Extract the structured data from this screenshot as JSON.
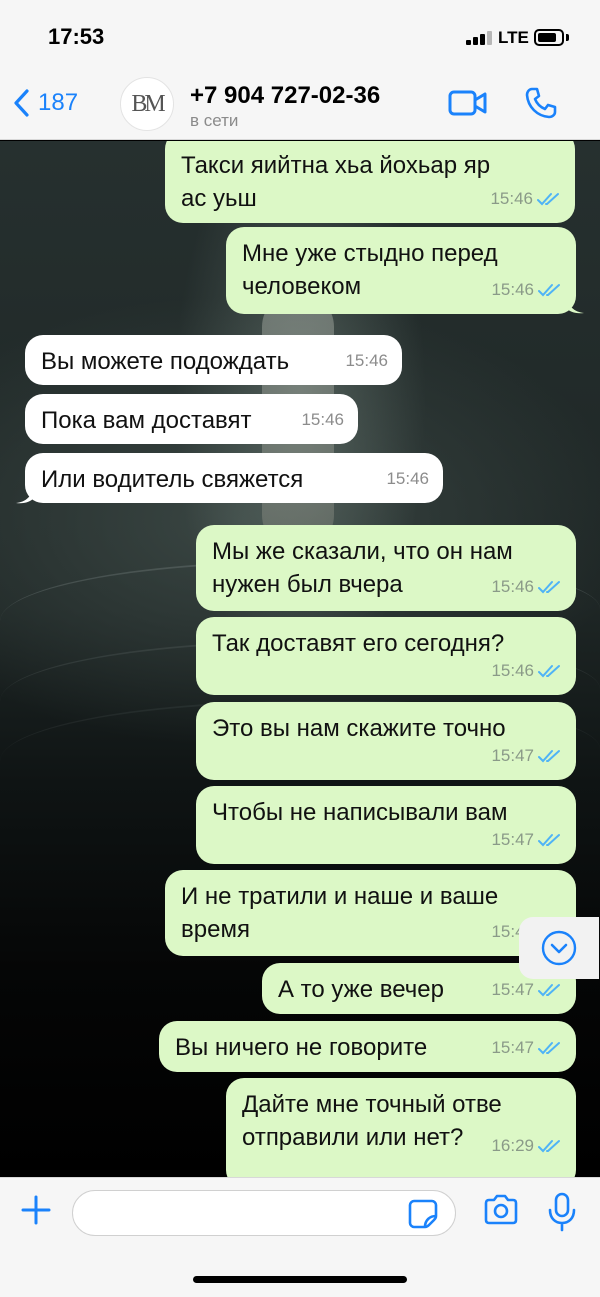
{
  "status_bar": {
    "time": "17:53",
    "network": "LTE",
    "battery_pct": 80
  },
  "header": {
    "back_count": "187",
    "avatar_text": "BM",
    "contact_name": "+7 904 727-02-36",
    "contact_status": "в сети",
    "icons": {
      "back": "chevron-left-icon",
      "video": "video-camera-icon",
      "call": "phone-icon"
    }
  },
  "messages": [
    {
      "dir": "out",
      "text": "Такси яийтна хьа йохьар яр ас уьш",
      "time": "15:46",
      "read": true
    },
    {
      "dir": "out",
      "text": "Мне уже стыдно перед человеком",
      "time": "15:46",
      "read": true
    },
    {
      "dir": "in",
      "text": "Вы можете подождать",
      "time": "15:46"
    },
    {
      "dir": "in",
      "text": "Пока вам доставят",
      "time": "15:46"
    },
    {
      "dir": "in",
      "text": "Или водитель свяжется",
      "time": "15:46"
    },
    {
      "dir": "out",
      "text": "Мы же сказали, что он нам нужен был вчера",
      "time": "15:46",
      "read": true
    },
    {
      "dir": "out",
      "text": "Так доставят его сегодня?",
      "time": "15:46",
      "read": true
    },
    {
      "dir": "out",
      "text": "Это вы нам скажите точно",
      "time": "15:47",
      "read": true
    },
    {
      "dir": "out",
      "text": "Чтобы не написывали вам",
      "time": "15:47",
      "read": true
    },
    {
      "dir": "out",
      "text": "И не тратили и наше и ваше время",
      "time": "15:47",
      "read": true
    },
    {
      "dir": "out",
      "text": "А то уже вечер",
      "time": "15:47",
      "read": true
    },
    {
      "dir": "out",
      "text": "Вы ничего не говорите",
      "time": "15:47",
      "read": true
    },
    {
      "dir": "out",
      "text": "Дайте мне точный отве отправили или нет?",
      "time": "16:29",
      "read": true
    }
  ],
  "input_bar": {
    "message_placeholder": "",
    "icons": {
      "attach": "plus-icon",
      "sticker": "sticker-icon",
      "camera": "camera-icon",
      "mic": "microphone-icon"
    }
  },
  "scroll_down": {
    "icon": "chevron-down-icon"
  },
  "colors": {
    "accent": "#1a82fb",
    "outgoing_bubble": "#dcf8c6",
    "incoming_bubble": "#ffffff",
    "read_ticks": "#4fb3f6"
  }
}
